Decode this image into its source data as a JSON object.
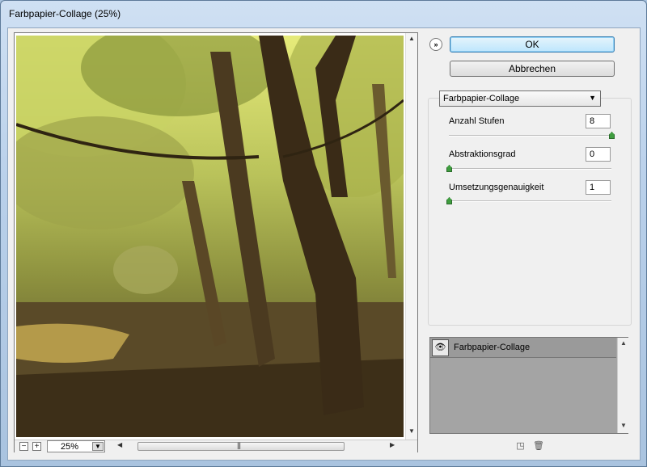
{
  "window": {
    "title": "Farbpapier-Collage (25%)"
  },
  "preview": {
    "zoom_value": "25%",
    "zoom_out_symbol": "−",
    "zoom_in_symbol": "+",
    "dropdown_arrow": "▼",
    "scroll_grip": "|||",
    "scroll_left": "◀",
    "scroll_right": "▶",
    "scroll_up": "▲",
    "scroll_down": "▼",
    "image_description_icon": "forest-image"
  },
  "actions": {
    "collapse_symbol": "»",
    "ok_label": "OK",
    "cancel_label": "Abbrechen"
  },
  "filter": {
    "selected": "Farbpapier-Collage",
    "dropdown_arrow": "▼",
    "params": [
      {
        "label": "Anzahl Stufen",
        "value": "8",
        "level": 1.0
      },
      {
        "label": "Abstraktionsgrad",
        "value": "0",
        "level": 0.0
      },
      {
        "label": "Umsetzungsgenauigkeit",
        "value": "1",
        "level": 0.0
      }
    ]
  },
  "layers": {
    "items": [
      {
        "name": "Farbpapier-Collage",
        "visible": true
      }
    ],
    "eye_symbol": "👁",
    "new_layer_icon": "new-layer-icon",
    "delete_icon": "trash-icon",
    "new_layer_symbol": "◳",
    "delete_symbol": "🗑"
  },
  "colors": {
    "ok_button": "#bde6fd",
    "slider_thumb": "#3f9d3f",
    "title_bar": "#b9d0ea"
  }
}
